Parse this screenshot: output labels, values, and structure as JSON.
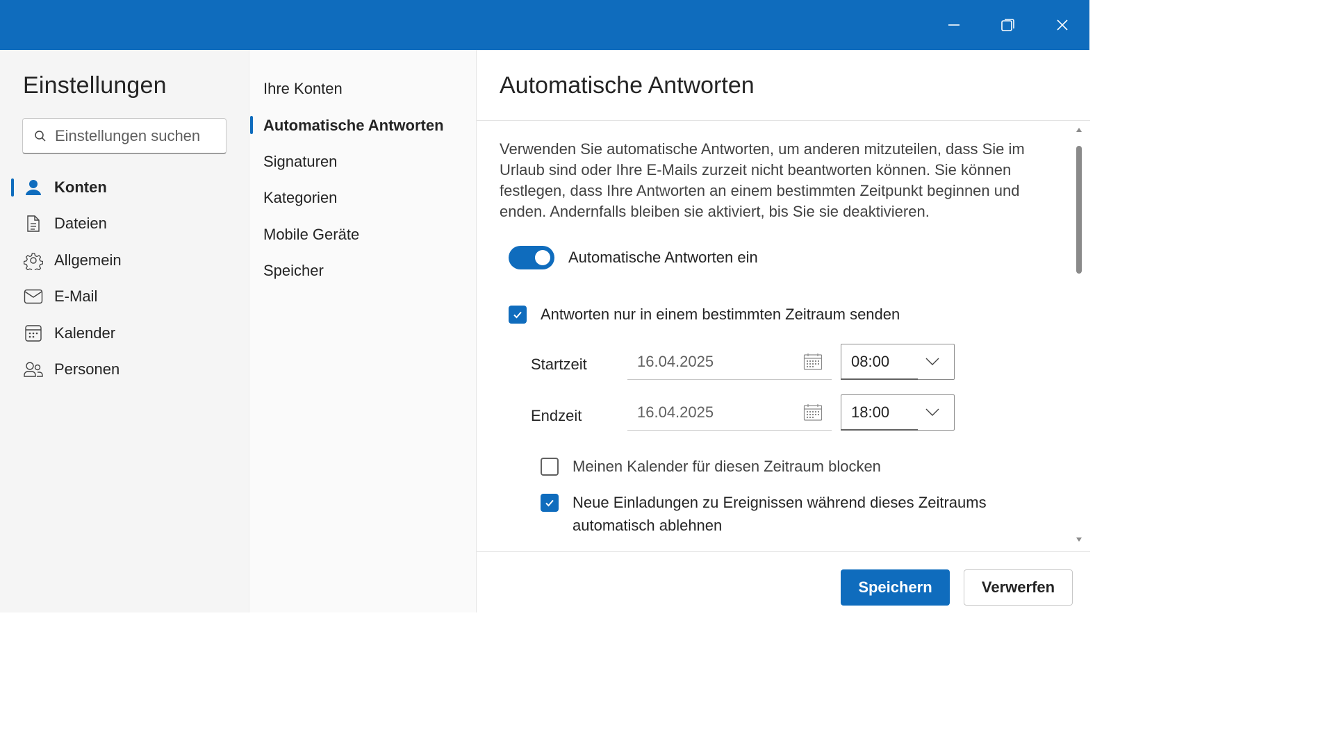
{
  "window": {
    "minimize_icon": "minimize-icon",
    "restore_icon": "restore-icon",
    "close_icon": "close-icon"
  },
  "sidebar": {
    "title": "Einstellungen",
    "search": {
      "placeholder": "Einstellungen suchen",
      "value": ""
    },
    "items": [
      {
        "label": "Konten",
        "icon": "person-icon",
        "active": true
      },
      {
        "label": "Dateien",
        "icon": "document-icon",
        "active": false
      },
      {
        "label": "Allgemein",
        "icon": "gear-icon",
        "active": false
      },
      {
        "label": "E-Mail",
        "icon": "mail-icon",
        "active": false
      },
      {
        "label": "Kalender",
        "icon": "calendar-icon",
        "active": false
      },
      {
        "label": "Personen",
        "icon": "people-icon",
        "active": false
      }
    ]
  },
  "subnav": {
    "items": [
      {
        "label": "Ihre Konten",
        "active": false
      },
      {
        "label": "Automatische Antworten",
        "active": true
      },
      {
        "label": "Signaturen",
        "active": false
      },
      {
        "label": "Kategorien",
        "active": false
      },
      {
        "label": "Mobile Geräte",
        "active": false
      },
      {
        "label": "Speicher",
        "active": false
      }
    ]
  },
  "main": {
    "title": "Automatische Antworten",
    "description": "Verwenden Sie automatische Antworten, um anderen mitzuteilen, dass Sie im Urlaub sind oder Ihre E-Mails zurzeit nicht beantworten können. Sie können festlegen, dass Ihre Antworten an einem bestimmten Zeitpunkt beginnen und enden. Andernfalls bleiben sie aktiviert, bis Sie sie deaktivieren.",
    "toggle": {
      "label": "Automatische Antworten ein",
      "on": true
    },
    "time_range_checkbox": {
      "label": "Antworten nur in einem bestimmten Zeitraum senden",
      "checked": true
    },
    "start": {
      "label": "Startzeit",
      "date": "16.04.2025",
      "time": "08:00"
    },
    "end": {
      "label": "Endzeit",
      "date": "16.04.2025",
      "time": "18:00"
    },
    "block_calendar": {
      "label": "Meinen Kalender für diesen Zeitraum blocken",
      "checked": false
    },
    "decline_invites": {
      "label": "Neue Einladungen zu Ereignissen während dieses Zeitraums automatisch ablehnen",
      "checked": true
    },
    "save_label": "Speichern",
    "discard_label": "Verwerfen"
  },
  "colors": {
    "accent": "#0f6cbd",
    "titlebar": "#0f6cbd",
    "sidebar_bg": "#f5f5f5",
    "subnav_bg": "#fafafa"
  }
}
